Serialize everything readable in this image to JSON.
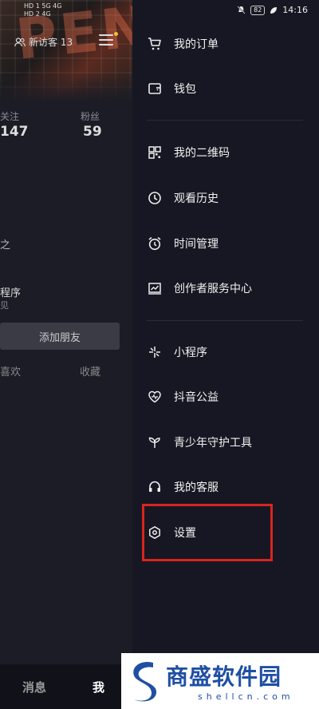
{
  "status": {
    "left_lines": [
      "HD 1  5G 4G",
      "HD 2  4G"
    ],
    "battery": "82",
    "time": "14:16"
  },
  "profile": {
    "visitors": "新访客 13",
    "following_label": "关注",
    "following_value": "147",
    "fans_label": "粉丝",
    "fans_value": "59",
    "frag1": "之",
    "frag2": "程序",
    "frag3": "见",
    "add_friend": "添加朋友",
    "tab_likes": "喜欢",
    "tab_favorites": "收藏"
  },
  "bottom_nav": {
    "messages": "消息",
    "me": "我"
  },
  "menu": {
    "items": [
      {
        "label": "我的订单",
        "icon": "cart-icon"
      },
      {
        "label": "钱包",
        "icon": "wallet-icon"
      },
      {
        "label": "我的二维码",
        "icon": "qrcode-icon"
      },
      {
        "label": "观看历史",
        "icon": "clock-icon"
      },
      {
        "label": "时间管理",
        "icon": "alarm-icon"
      },
      {
        "label": "创作者服务中心",
        "icon": "chart-icon"
      },
      {
        "label": "小程序",
        "icon": "sparkle-icon"
      },
      {
        "label": "抖音公益",
        "icon": "heart-icon"
      },
      {
        "label": "青少年守护工具",
        "icon": "sprout-icon"
      },
      {
        "label": "我的客服",
        "icon": "headset-icon"
      },
      {
        "label": "设置",
        "icon": "hexagon-gear-icon"
      }
    ]
  },
  "watermark": {
    "title": "商盛软件园",
    "site": "shellcn.com"
  },
  "colors": {
    "highlight": "#d9241e",
    "brand_blue": "#1f4fa3"
  }
}
